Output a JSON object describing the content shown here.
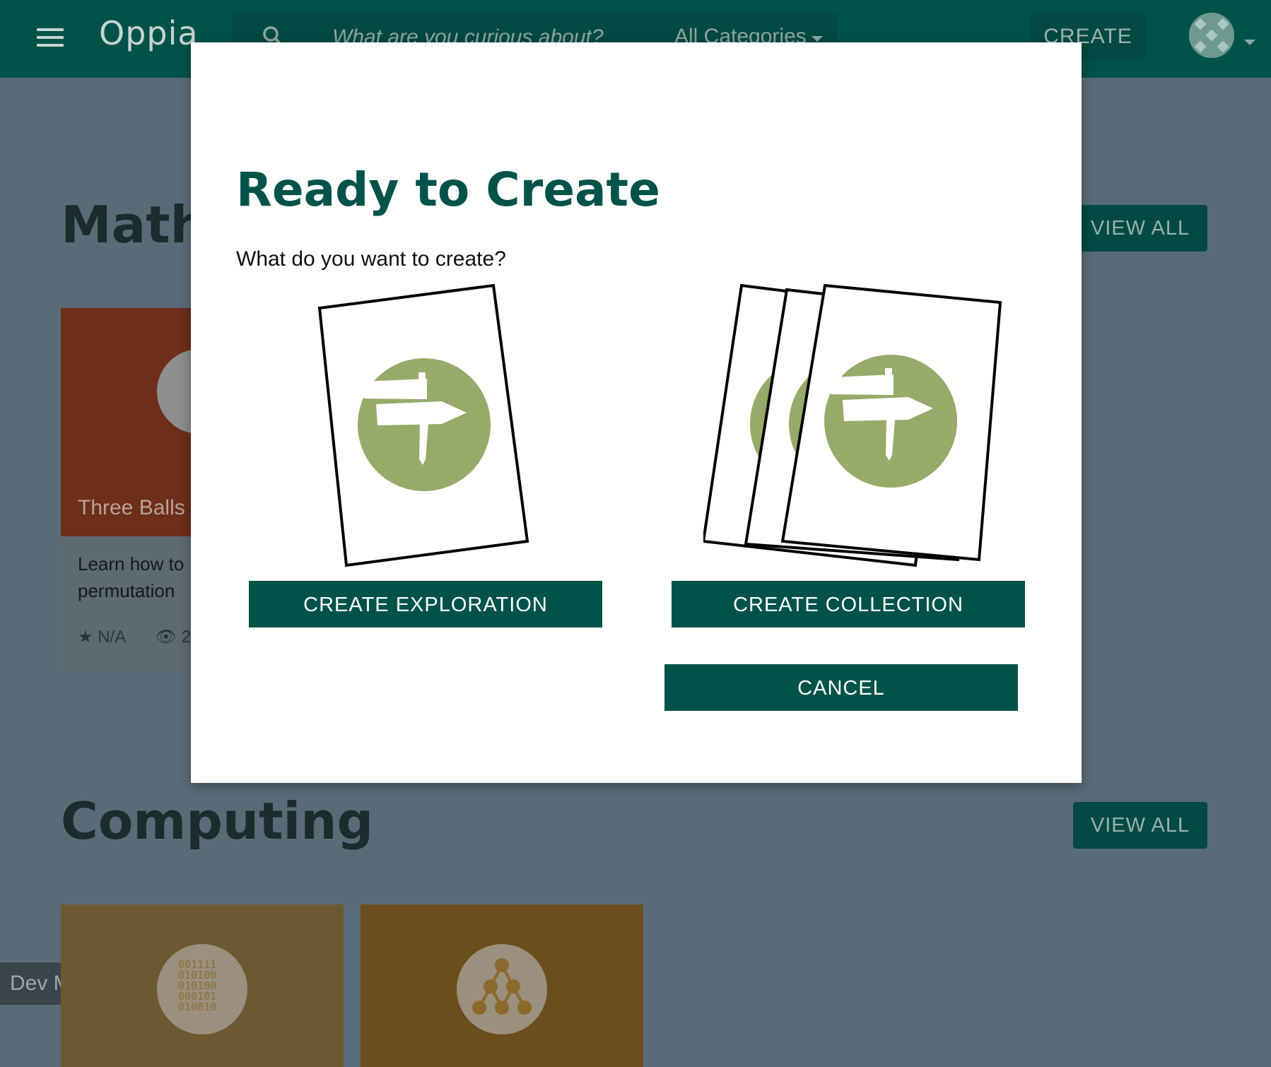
{
  "navbar": {
    "logo_text": "Oppia",
    "search_placeholder": "What are you curious about?",
    "category_label": "All Categories",
    "create_label": "CREATE",
    "menu_icon": "hamburger-icon",
    "search_icon": "magnifier-icon"
  },
  "sections": {
    "math": {
      "title": "Math",
      "view_all_label": "VIEW ALL",
      "card": {
        "title": "Three Balls",
        "description": "Learn how to permutation",
        "rating": "N/A",
        "views": "2"
      }
    },
    "computing": {
      "title": "Computing",
      "view_all_label": "VIEW ALL",
      "card1_icon_text": "001111\n010100\n010100\n000101\n010010"
    }
  },
  "dev_mode_label": "Dev M",
  "modal": {
    "title": "Ready to Create",
    "subtitle": "What do you want to create?",
    "create_exploration_label": "CREATE EXPLORATION",
    "create_collection_label": "CREATE COLLECTION",
    "cancel_label": "CANCEL"
  },
  "colors": {
    "brand": "#01534a",
    "card_green": "#96aa69",
    "overlay": "#5a6b78"
  }
}
